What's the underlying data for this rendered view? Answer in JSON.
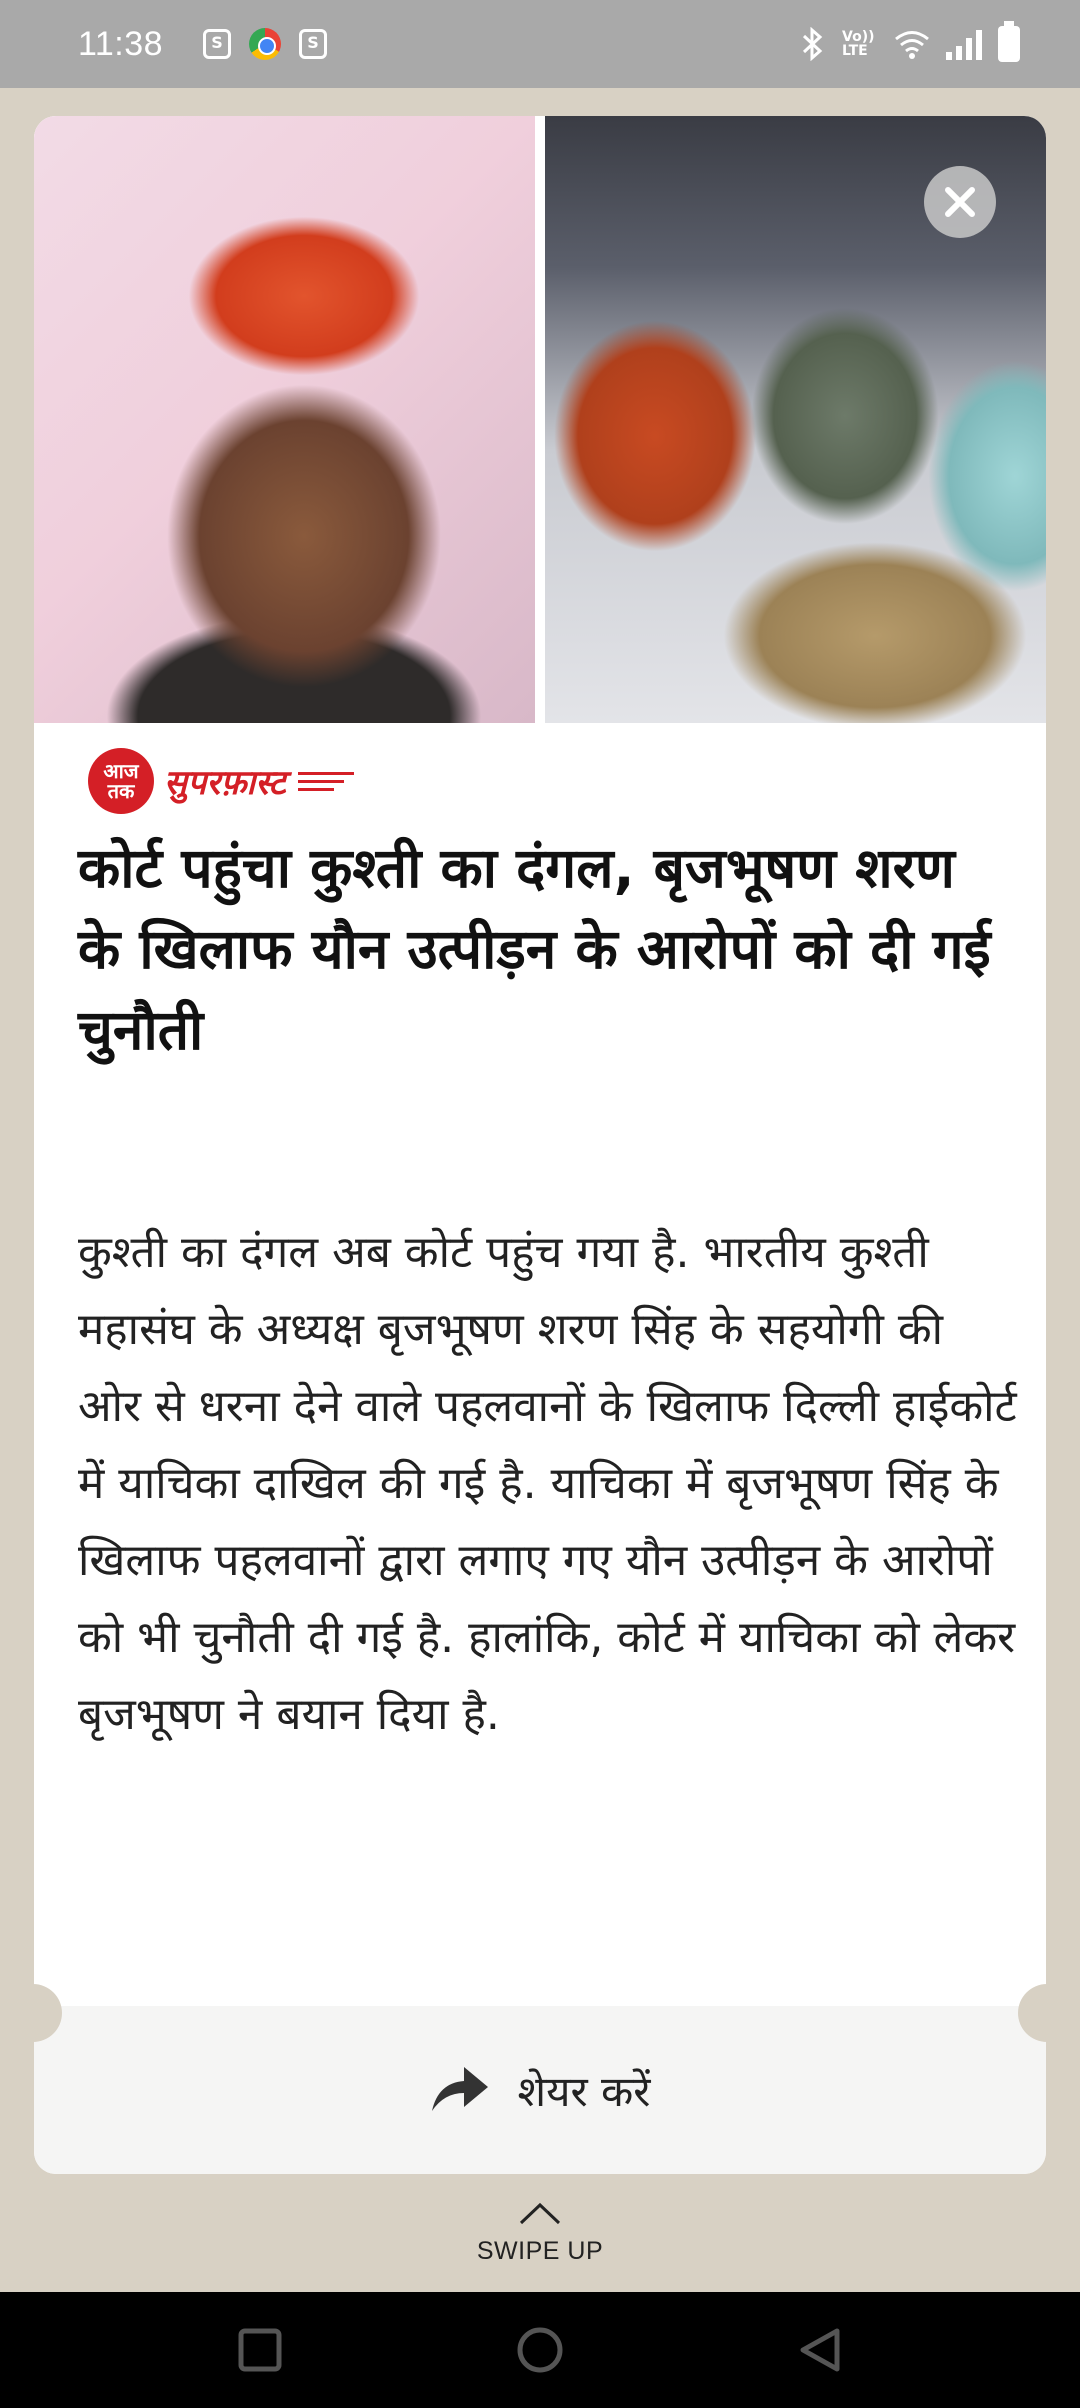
{
  "status_bar": {
    "time": "11:38",
    "left_icons": [
      "app-s-icon",
      "chrome-icon",
      "app-s-icon"
    ],
    "right_icons": [
      "bluetooth-icon",
      "volte-icon",
      "wifi-icon",
      "signal-icon",
      "battery-icon"
    ],
    "volte_label": "Vo)) LTE",
    "app_glyph": "S"
  },
  "story": {
    "brand_logo_text": "आज तक",
    "brand_name": "सुपरफ़ास्ट",
    "headline": "कोर्ट पहुंचा कुश्ती का दंगल, बृजभूषण शरण के खिलाफ यौन उत्पीड़न के आरोपों को दी गई चुनौती",
    "body": "कुश्ती का दंगल अब कोर्ट पहुंच गया है. भारतीय कुश्ती महासंघ के अध्यक्ष बृजभूषण शरण सिंह के सहयोगी की ओर से धरना देने वाले पहलवानों के खिलाफ दिल्ली हाईकोर्ट में याचिका दाखिल की गई है. याचिका में बृजभूषण सिंह के खिलाफ पहलवानों द्वारा लगाए गए यौन उत्पीड़न के आरोपों को भी चुनौती दी गई है. हालांकि, कोर्ट में याचिका को लेकर बृजभूषण ने बयान दिया है."
  },
  "share": {
    "label": "शेयर करें",
    "icon": "share-arrow-icon"
  },
  "swipe": {
    "label": "SWIPE UP",
    "icon": "chevron-up-icon"
  },
  "nav": {
    "icons": [
      "recents-square-icon",
      "home-circle-icon",
      "back-triangle-icon"
    ]
  },
  "colors": {
    "brand_red": "#d41f26",
    "page_bg": "#d8d1c4",
    "status_bar": "#a9a9a9"
  }
}
